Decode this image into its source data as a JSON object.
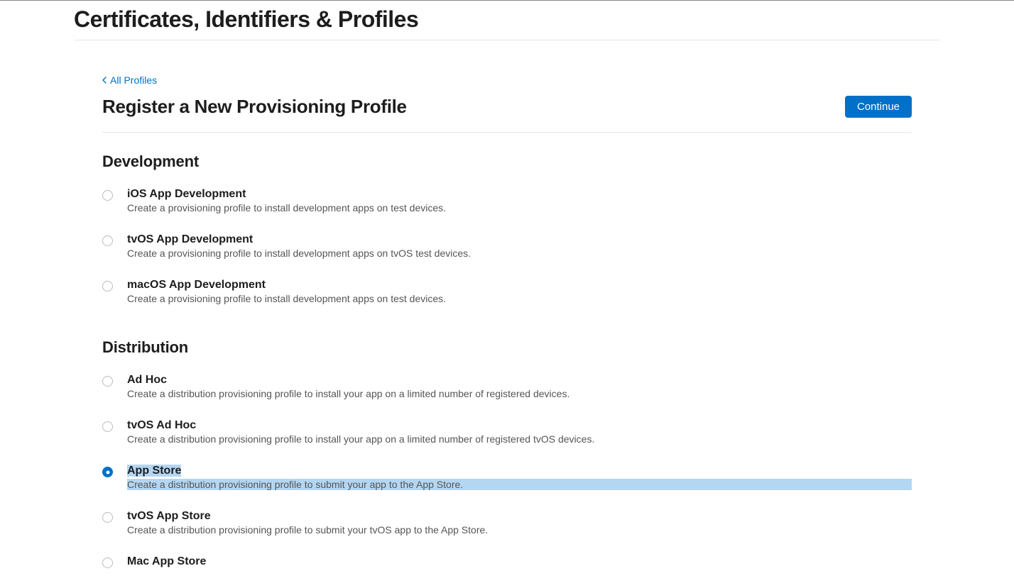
{
  "pageTitle": "Certificates, Identifiers & Profiles",
  "breadcrumb": {
    "label": "All Profiles"
  },
  "subtitle": "Register a New Provisioning Profile",
  "continueLabel": "Continue",
  "sections": [
    {
      "heading": "Development",
      "options": [
        {
          "title": "iOS App Development",
          "desc": "Create a provisioning profile to install development apps on test devices.",
          "selected": false,
          "highlighted": false
        },
        {
          "title": "tvOS App Development",
          "desc": "Create a provisioning profile to install development apps on tvOS test devices.",
          "selected": false,
          "highlighted": false
        },
        {
          "title": "macOS App Development",
          "desc": "Create a provisioning profile to install development apps on test devices.",
          "selected": false,
          "highlighted": false
        }
      ]
    },
    {
      "heading": "Distribution",
      "options": [
        {
          "title": "Ad Hoc",
          "desc": "Create a distribution provisioning profile to install your app on a limited number of registered devices.",
          "selected": false,
          "highlighted": false
        },
        {
          "title": "tvOS Ad Hoc",
          "desc": "Create a distribution provisioning profile to install your app on a limited number of registered tvOS devices.",
          "selected": false,
          "highlighted": false
        },
        {
          "title": "App Store",
          "desc": "Create a distribution provisioning profile to submit your app to the App Store.",
          "selected": true,
          "highlighted": true
        },
        {
          "title": "tvOS App Store",
          "desc": "Create a distribution provisioning profile to submit your tvOS app to the App Store.",
          "selected": false,
          "highlighted": false
        },
        {
          "title": "Mac App Store",
          "desc": "",
          "selected": false,
          "highlighted": false
        }
      ]
    }
  ]
}
